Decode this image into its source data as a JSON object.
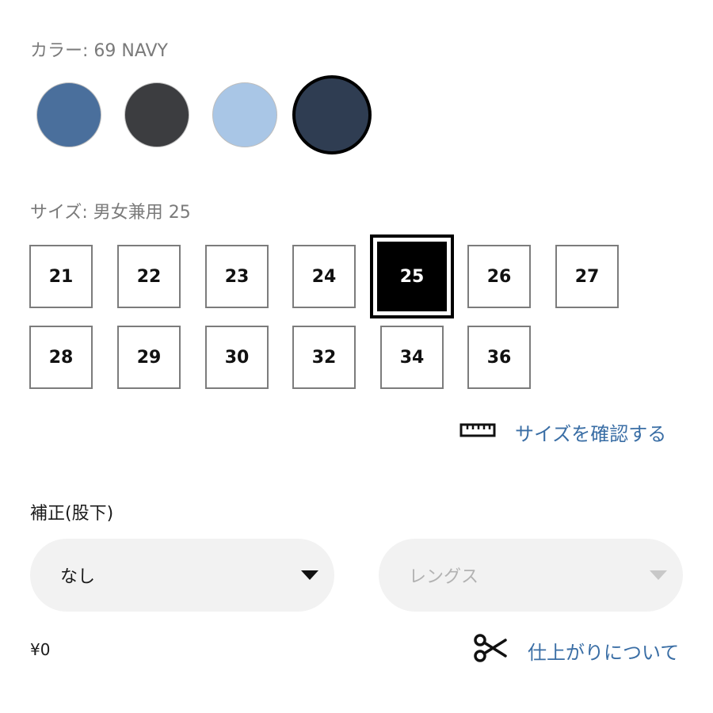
{
  "color": {
    "label": "カラー: 69 NAVY",
    "swatches": [
      {
        "name": "blue-denim",
        "color": "#4a6f9c",
        "selected": false
      },
      {
        "name": "black-denim",
        "color": "#3c3d40",
        "selected": false
      },
      {
        "name": "light-blue-denim",
        "color": "#a9c6e6",
        "selected": false
      },
      {
        "name": "navy-denim",
        "color": "#2f3d52",
        "selected": true
      }
    ]
  },
  "size": {
    "label": "サイズ: 男女兼用 25",
    "options": [
      "21",
      "22",
      "23",
      "24",
      "25",
      "26",
      "27",
      "28",
      "29",
      "30",
      "32",
      "34",
      "36"
    ],
    "selected": "25"
  },
  "size_check": {
    "label": "サイズを確認する",
    "icon": "ruler-icon"
  },
  "hem": {
    "label": "補正(股下)",
    "option_select": {
      "value": "なし"
    },
    "length_select": {
      "placeholder": "レングス"
    }
  },
  "price": "¥0",
  "finish_link": {
    "label": "仕上がりについて",
    "icon": "scissors-icon"
  },
  "colors": {
    "link": "#3a6ea5",
    "selected": "#000000",
    "select_bg": "#f2f2f2"
  }
}
